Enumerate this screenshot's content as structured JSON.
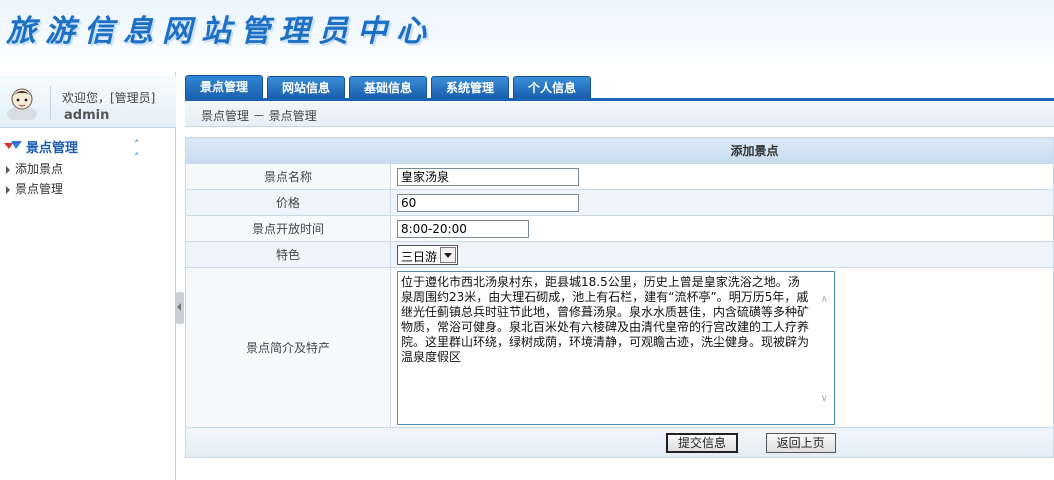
{
  "header": {
    "title": "旅游信息网站管理员中心"
  },
  "user": {
    "welcome": "欢迎您，[管理员]",
    "name": "admin"
  },
  "sidebar": {
    "section_label": "景点管理",
    "items": [
      {
        "label": "添加景点"
      },
      {
        "label": "景点管理"
      }
    ]
  },
  "tabs": [
    {
      "label": "景点管理",
      "active": true
    },
    {
      "label": "网站信息"
    },
    {
      "label": "基础信息"
    },
    {
      "label": "系统管理"
    },
    {
      "label": "个人信息"
    }
  ],
  "breadcrumb": {
    "text": "景点管理 － 景点管理"
  },
  "form": {
    "title": "添加景点",
    "fields": {
      "name": {
        "label": "景点名称",
        "value": "皇家汤泉"
      },
      "price": {
        "label": "价格",
        "value": "60"
      },
      "hours": {
        "label": "景点开放时间",
        "value": "8:00-20:00"
      },
      "feature": {
        "label": "特色",
        "value": "三日游"
      },
      "intro": {
        "label": "景点简介及特产",
        "value": "位于遵化市西北汤泉村东，距县城18.5公里，历史上曾是皇家洗浴之地。汤泉周围约23米，由大理石砌成，池上有石栏，建有“流杯亭”。明万历5年，戚继光任蓟镇总兵时驻节此地，曾修葺汤泉。泉水水质甚佳，内含硫磺等多种矿物质，常浴可健身。泉北百米处有六棱碑及由清代皇帝的行宫改建的工人疗养院。这里群山环绕，绿树成荫，环境清静，可观瞻古迹，洗尘健身。现被辟为温泉度假区"
      }
    },
    "submit_label": "提交信息",
    "back_label": "返回上页"
  }
}
